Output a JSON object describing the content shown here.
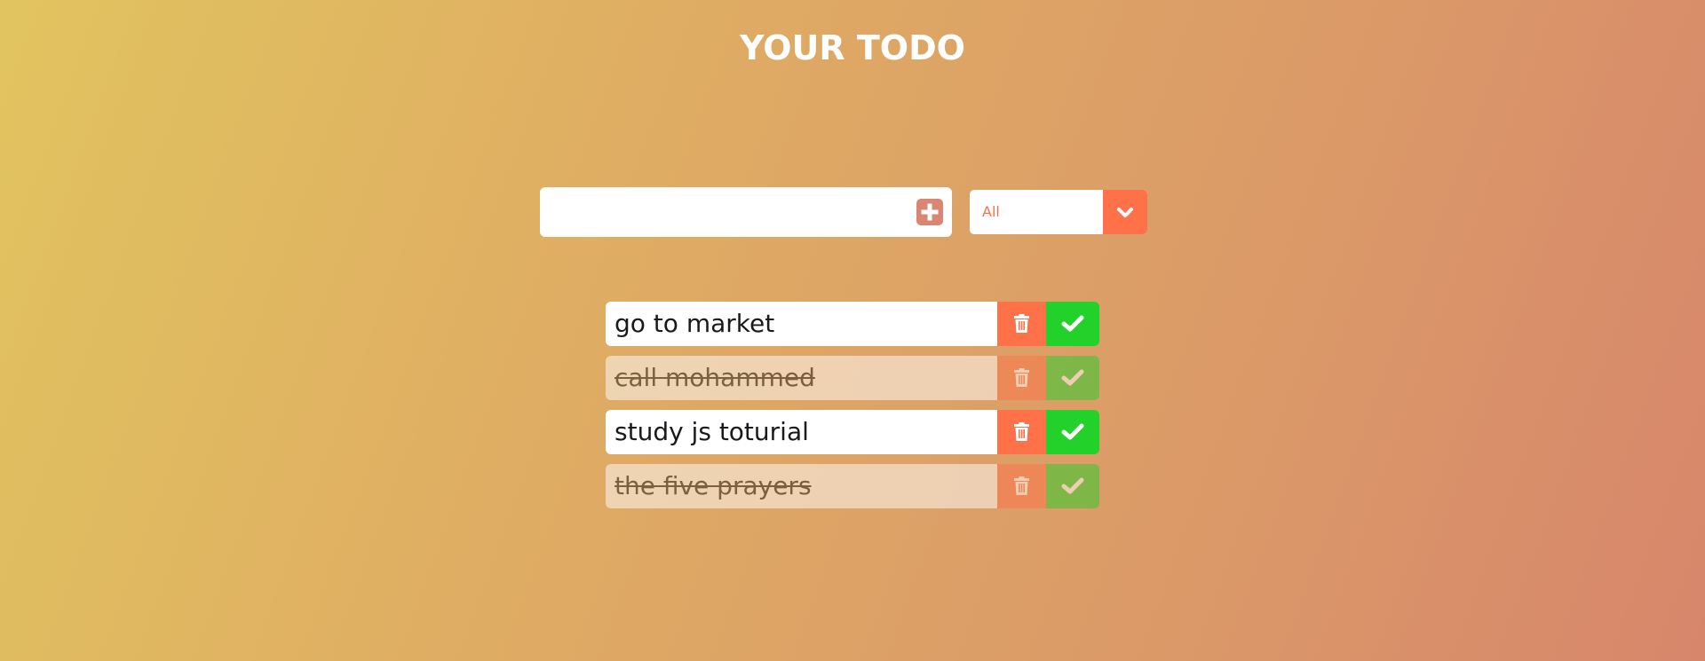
{
  "header": {
    "title": "YOUR TODO"
  },
  "add_form": {
    "input_value": "",
    "placeholder": "",
    "add_icon": "plus-square-icon"
  },
  "filter": {
    "selected": "All",
    "arrow_icon": "chevron-down-icon"
  },
  "todos": [
    {
      "text": "go to market",
      "completed": false
    },
    {
      "text": "call mohammed",
      "completed": true
    },
    {
      "text": "study js toturial",
      "completed": false
    },
    {
      "text": "the five prayers",
      "completed": true
    }
  ],
  "icons": {
    "delete": "trash-icon",
    "complete": "check-icon"
  },
  "colors": {
    "delete_button": "#fe7149",
    "complete_button": "#22d12a",
    "add_button": "#d98673",
    "filter_text": "#f07452",
    "title": "#ffffff"
  }
}
